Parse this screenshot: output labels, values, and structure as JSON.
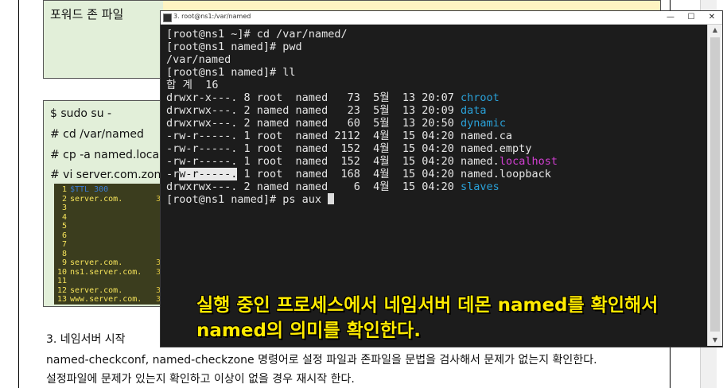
{
  "document": {
    "forward_zone_label": "포워드 존 파일",
    "commands": [
      "$ sudo su -",
      "# cd /var/named",
      "# cp -a named.localh",
      "# vi server.com.zone"
    ],
    "code_rows": [
      {
        "ln": "1",
        "text": "$TTL 300",
        "extra": "",
        "color": "blue"
      },
      {
        "ln": "2",
        "text": "server.com.",
        "extra": "3",
        "color": "yellow"
      },
      {
        "ln": "3",
        "text": "",
        "extra": "",
        "color": "yellow"
      },
      {
        "ln": "4",
        "text": "",
        "extra": "",
        "color": "yellow"
      },
      {
        "ln": "5",
        "text": "",
        "extra": "",
        "color": "yellow"
      },
      {
        "ln": "6",
        "text": "",
        "extra": "",
        "color": "yellow"
      },
      {
        "ln": "7",
        "text": "",
        "extra": "",
        "color": "yellow"
      },
      {
        "ln": "8",
        "text": "",
        "extra": "",
        "color": "yellow"
      },
      {
        "ln": "9",
        "text": "server.com.",
        "extra": "3",
        "color": "yellow"
      },
      {
        "ln": "10",
        "text": "ns1.server.com.",
        "extra": "3",
        "color": "yellow"
      },
      {
        "ln": "11",
        "text": "",
        "extra": "",
        "color": "yellow"
      },
      {
        "ln": "12",
        "text": "server.com.",
        "extra": "3",
        "color": "yellow"
      },
      {
        "ln": "13",
        "text": "www.server.com.",
        "extra": "3",
        "color": "yellow"
      }
    ],
    "section_title": "3. 네임서버 시작",
    "paragraph_line1": "named-checkconf, named-checkzone 명령어로 설정 파일과 존파일을 문법을 검사해서 문제가 없는지 확인한다.",
    "paragraph_line2": "설정파일에 문제가 있는지 확인하고 이상이 없을 경우 재시작 한다."
  },
  "terminal": {
    "window_title": "3. root@ns1:/var/named",
    "buttons": {
      "minimize": "—",
      "maximize": "☐",
      "close": "✕"
    },
    "lines": [
      [
        {
          "t": "[root@ns1 ~]# cd /var/named/"
        }
      ],
      [
        {
          "t": "[root@ns1 named]# pwd"
        }
      ],
      [
        {
          "t": "/var/named"
        }
      ],
      [
        {
          "t": "[root@ns1 named]# ll"
        }
      ],
      [
        {
          "t": "합 계  16"
        }
      ],
      [
        {
          "t": "drwxr-x---. 8 root  named   73  5월  13 20:07 "
        },
        {
          "t": "chroot",
          "c": "c-blue"
        }
      ],
      [
        {
          "t": "drwxrwx---. 2 named named   23  5월  13 20:09 "
        },
        {
          "t": "data",
          "c": "c-blue"
        }
      ],
      [
        {
          "t": "drwxrwx---. 2 named named   60  5월  13 20:50 "
        },
        {
          "t": "dynamic",
          "c": "c-blue"
        }
      ],
      [
        {
          "t": "-rw-r-----. 1 root  named 2112  4월  15 04:20 named.ca"
        }
      ],
      [
        {
          "t": "-rw-r-----. 1 root  named  152  4월  15 04:20 named.empty"
        }
      ],
      [
        {
          "t": "-rw-r-----. 1 root  named  152  4월  15 04:20 named."
        },
        {
          "t": "localhost",
          "c": "c-mag"
        }
      ],
      [
        {
          "t": "-r"
        },
        {
          "t": "w-r-----.",
          "c": "c-hl"
        },
        {
          "t": " 1 root  named  168  4월  15 04:20 named.loopback"
        }
      ],
      [
        {
          "t": "drwxrwx---. 2 named named    6  4월  15 04:20 "
        },
        {
          "t": "slaves",
          "c": "c-blue"
        }
      ],
      [
        {
          "t": "[root@ns1 named]# ps aux "
        },
        {
          "t": "",
          "c": "cursor"
        }
      ]
    ],
    "subtitle_line1": "실행 중인 프로세스에서 네임서버 데몬 named를 확인해서",
    "subtitle_line2": "named의 의미를 확인한다."
  }
}
